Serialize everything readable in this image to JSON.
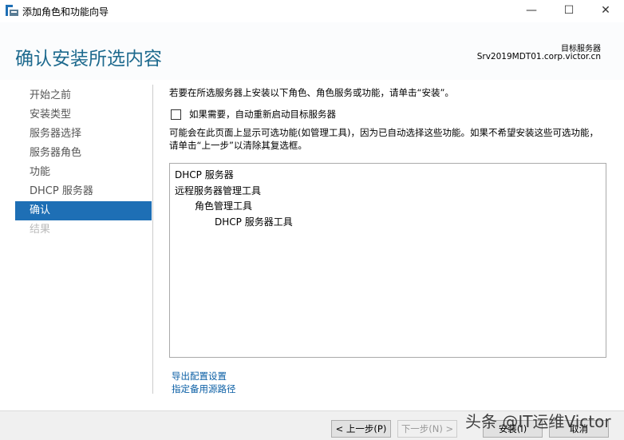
{
  "window": {
    "title": "添加角色和功能向导",
    "minimize": "—",
    "maximize": "☐",
    "close": "✕"
  },
  "header": {
    "page_title": "确认安装所选内容",
    "target_label": "目标服务器",
    "target_name": "Srv2019MDT01.corp.victor.cn"
  },
  "nav": {
    "items": [
      {
        "label": "开始之前"
      },
      {
        "label": "安装类型"
      },
      {
        "label": "服务器选择"
      },
      {
        "label": "服务器角色"
      },
      {
        "label": "功能"
      },
      {
        "label": "DHCP 服务器"
      },
      {
        "label": "确认"
      },
      {
        "label": "结果"
      }
    ]
  },
  "main": {
    "intro": "若要在所选服务器上安装以下角色、角色服务或功能，请单击“安装”。",
    "restart_label": "如果需要，自动重新启动目标服务器",
    "restart_checked": false,
    "note": "可能会在此页面上显示可选功能(如管理工具)，因为已自动选择这些功能。如果不希望安装这些可选功能，请单击“上一步”以清除其复选框。",
    "items": [
      "DHCP 服务器",
      "远程服务器管理工具",
      "角色管理工具",
      "DHCP 服务器工具"
    ],
    "export_link": "导出配置设置",
    "alt_source_link": "指定备用源路径"
  },
  "footer": {
    "prev": "< 上一步(P)",
    "next": "下一步(N) >",
    "install": "安装(I)",
    "cancel": "取消"
  },
  "watermark": "头条 @IT运维Victor"
}
